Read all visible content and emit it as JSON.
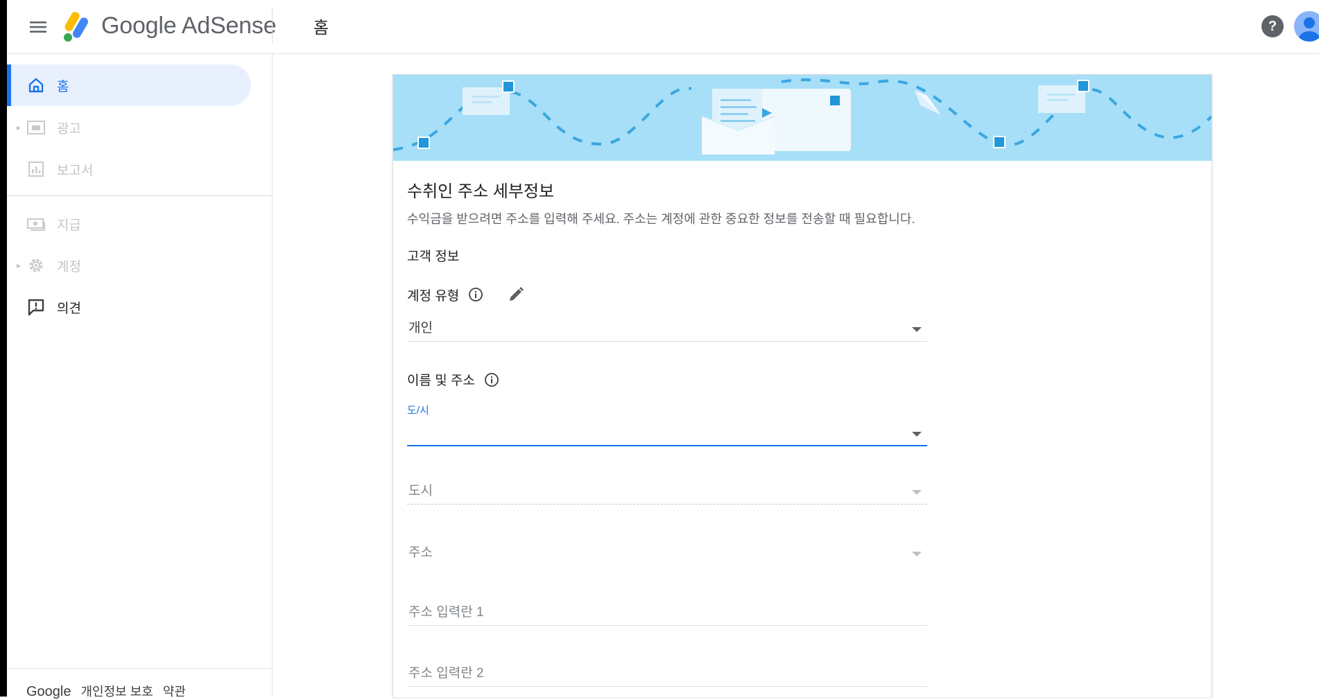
{
  "header": {
    "brand": "Google AdSense",
    "page_title": "홈",
    "help_label": "?"
  },
  "sidebar": {
    "items": [
      {
        "label": "홈",
        "icon": "home-icon",
        "state": "active"
      },
      {
        "label": "광고",
        "icon": "ads-icon",
        "state": "disabled",
        "expandable": true
      },
      {
        "label": "보고서",
        "icon": "reports-icon",
        "state": "disabled"
      },
      {
        "label": "지급",
        "icon": "payments-icon",
        "state": "disabled"
      },
      {
        "label": "계정",
        "icon": "gear-icon",
        "state": "disabled",
        "expandable": true
      },
      {
        "label": "의견",
        "icon": "feedback-icon",
        "state": "normal"
      }
    ],
    "footer": {
      "google": "Google",
      "privacy": "개인정보 보호",
      "terms": "약관"
    }
  },
  "form": {
    "title": "수취인 주소 세부정보",
    "description": "수익금을 받으려면 주소를 입력해 주세요. 주소는 계정에 관한 중요한 정보를 전송할 때 필요합니다.",
    "section_title": "고객 정보",
    "account_type": {
      "label": "계정 유형",
      "value": "개인"
    },
    "name_address": {
      "label": "이름 및 주소"
    },
    "province": {
      "floating_label": "도/시",
      "value": ""
    },
    "city": {
      "placeholder": "도시"
    },
    "address": {
      "placeholder": "주소"
    },
    "address_line1": {
      "placeholder": "주소 입력란 1"
    },
    "address_line2": {
      "placeholder": "주소 입력란 2"
    }
  },
  "colors": {
    "accent": "#1a73e8",
    "banner_bg": "#a6dff7",
    "active_bg": "#e8f0fe"
  }
}
